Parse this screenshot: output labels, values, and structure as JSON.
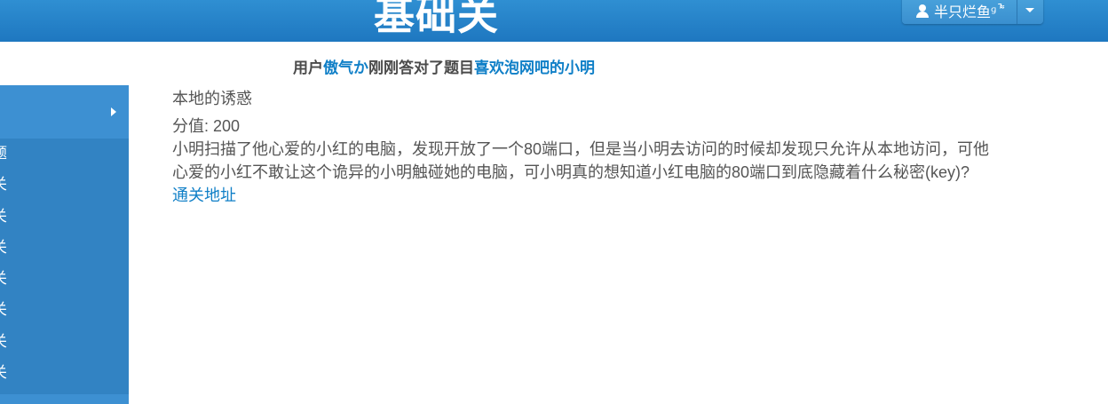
{
  "header": {
    "title": "基础关",
    "user_name": "半只烂鱼ᶢ ̚ ͌"
  },
  "announcement": {
    "prefix": "用户",
    "user": "傲气か",
    "middle": "刚刚答对了题目",
    "challenge": "喜欢泡网吧的小明"
  },
  "sidebar": {
    "items": [
      "题",
      "关",
      "关",
      "关",
      "关",
      "关",
      "关",
      "关"
    ]
  },
  "challenge": {
    "name": "本地的诱惑",
    "score_label": "分值:",
    "score_value": "200",
    "description": "小明扫描了他心爱的小红的电脑，发现开放了一个80端口，但是当小明去访问的时候却发现只允许从本地访问，可他心爱的小红不敢让这个诡异的小明触碰她的电脑，可小明真的想知道小红电脑的80端口到底隐藏着什么秘密(key)?",
    "link_text": "通关地址"
  },
  "colors": {
    "topbar": "#1e77c0",
    "sidebar": "#3283c3",
    "accent": "#0f7fc7"
  },
  "icons": [
    "user-icon",
    "caret-down-icon",
    "arrow-right-icon"
  ]
}
